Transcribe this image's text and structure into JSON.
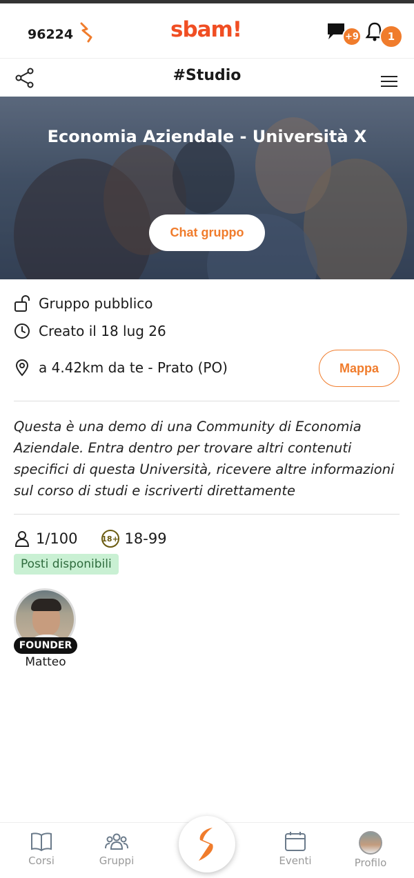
{
  "header": {
    "coins": "96224",
    "logo": "sbam!",
    "messages_badge": "+9",
    "notifications_badge": "1"
  },
  "subheader": {
    "title": "#Studio"
  },
  "hero": {
    "title": "Economia Aziendale - Università X",
    "chat_button": "Chat gruppo"
  },
  "info": {
    "visibility": "Gruppo pubblico",
    "created": "Creato il 18 lug 26",
    "location": "a 4.42km da te - Prato (PO)",
    "map_button": "Mappa"
  },
  "description": "Questa è una demo di una Community di Economia Aziendale. Entra dentro per trovare altri contenuti specifici di questa Università, ricevere altre informazioni sul corso di studi e iscriverti direttamente",
  "stats": {
    "members": "1/100",
    "age_icon": "18+",
    "age_range": "18-99",
    "availability": "Posti disponibili"
  },
  "members": [
    {
      "role": "FOUNDER",
      "name": "Matteo"
    }
  ],
  "tabs": [
    {
      "label": "Corsi"
    },
    {
      "label": "Gruppi"
    },
    {
      "label": "Eventi"
    },
    {
      "label": "Profilo"
    }
  ],
  "colors": {
    "accent": "#f07c2c",
    "brand": "#f04e23",
    "badge_green_bg": "#c9f0d3"
  },
  "icons": [
    "bolt-icon",
    "chat-icon",
    "bell-icon",
    "share-icon",
    "menu-icon",
    "lock-open-icon",
    "clock-icon",
    "location-pin-icon",
    "user-icon",
    "age-18-icon",
    "book-icon",
    "group-icon",
    "calendar-icon",
    "profile-avatar-icon"
  ]
}
